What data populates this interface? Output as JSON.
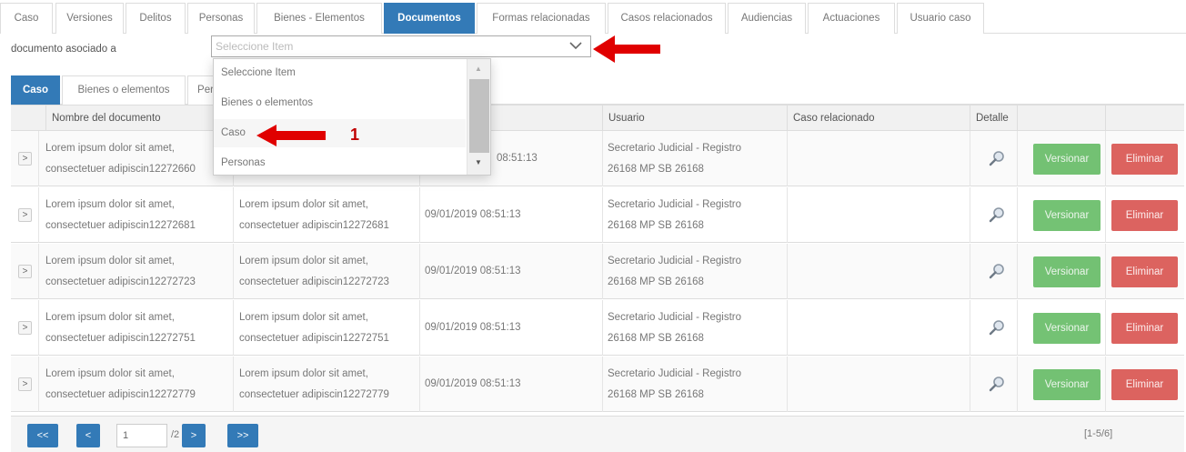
{
  "top_tabs": [
    "Caso",
    "Versiones",
    "Delitos",
    "Personas",
    "Bienes - Elementos",
    "Documentos",
    "Formas relacionadas",
    "Casos relacionados",
    "Audiencias",
    "Actuaciones",
    "Usuario caso"
  ],
  "active_top_tab": "Documentos",
  "filter": {
    "label": "documento asociado a",
    "placeholder": "Seleccione Item"
  },
  "inner_tabs": [
    "Caso",
    "Bienes o elementos",
    "Per"
  ],
  "dropdown": {
    "options": [
      "Seleccione Item",
      "Bienes o elementos",
      "Caso",
      "Personas"
    ],
    "highlighted": "Caso"
  },
  "annotation_label": "1",
  "table": {
    "headers": {
      "nombre": "Nombre del documento",
      "usuario": "Usuario",
      "caso_relacionado": "Caso relacionado",
      "detalle": "Detalle"
    },
    "rows": [
      {
        "nombre_1": "Lorem ipsum dolor sit amet,",
        "nombre_2": "consectetuer adipiscin12272660",
        "desc_1": "",
        "desc_2": "",
        "fecha": "08:51:13",
        "usuario_1": "Secretario Judicial - Registro",
        "usuario_2": "26168 MP SB 26168"
      },
      {
        "nombre_1": "Lorem ipsum dolor sit amet,",
        "nombre_2": "consectetuer adipiscin12272681",
        "desc_1": "Lorem ipsum dolor sit amet,",
        "desc_2": "consectetuer adipiscin12272681",
        "fecha": "09/01/2019 08:51:13",
        "usuario_1": "Secretario Judicial - Registro",
        "usuario_2": "26168 MP SB 26168"
      },
      {
        "nombre_1": "Lorem ipsum dolor sit amet,",
        "nombre_2": "consectetuer adipiscin12272723",
        "desc_1": "Lorem ipsum dolor sit amet,",
        "desc_2": "consectetuer adipiscin12272723",
        "fecha": "09/01/2019 08:51:13",
        "usuario_1": "Secretario Judicial - Registro",
        "usuario_2": "26168 MP SB 26168"
      },
      {
        "nombre_1": "Lorem ipsum dolor sit amet,",
        "nombre_2": "consectetuer adipiscin12272751",
        "desc_1": "Lorem ipsum dolor sit amet,",
        "desc_2": "consectetuer adipiscin12272751",
        "fecha": "09/01/2019 08:51:13",
        "usuario_1": "Secretario Judicial - Registro",
        "usuario_2": "26168 MP SB 26168"
      },
      {
        "nombre_1": "Lorem ipsum dolor sit amet,",
        "nombre_2": "consectetuer adipiscin12272779",
        "desc_1": "Lorem ipsum dolor sit amet,",
        "desc_2": "consectetuer adipiscin12272779",
        "fecha": "09/01/2019 08:51:13",
        "usuario_1": "Secretario Judicial - Registro",
        "usuario_2": "26168 MP SB 26168"
      }
    ],
    "expand_glyph": ">",
    "versionar_label": "Versionar",
    "eliminar_label": "Eliminar"
  },
  "pager": {
    "first": "<<",
    "prev": "<",
    "page": "1",
    "total": "/2",
    "next": ">",
    "last": ">>",
    "range": "[1-5/6]"
  },
  "colors": {
    "primary": "#337ab7",
    "success": "#5cb85c",
    "danger": "#d9534f",
    "annotation": "#e00000"
  }
}
